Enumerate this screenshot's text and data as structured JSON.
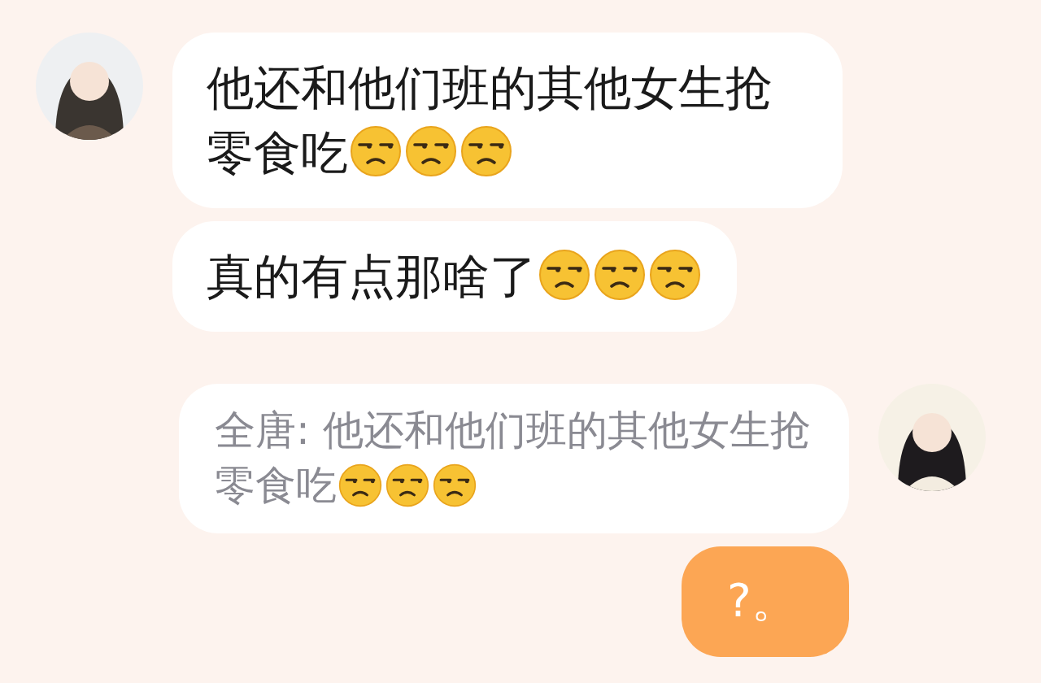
{
  "messages": [
    {
      "incoming": true,
      "kind": "text",
      "has_avatar": true,
      "segments": [
        {
          "kind": "text",
          "text": "他还和他们班的其他女生抢零食吃"
        },
        {
          "kind": "emoji"
        },
        {
          "kind": "emoji"
        },
        {
          "kind": "emoji"
        }
      ]
    },
    {
      "incoming": true,
      "kind": "text",
      "has_avatar": false,
      "segments": [
        {
          "kind": "text",
          "text": "真的有点那啥了"
        },
        {
          "kind": "emoji"
        },
        {
          "kind": "emoji"
        },
        {
          "kind": "emoji"
        }
      ]
    },
    {
      "incoming": false,
      "kind": "quote",
      "has_avatar": true,
      "segments": [
        {
          "kind": "text",
          "text": "全唐: 他还和他们班的其他女生抢零食吃"
        },
        {
          "kind": "emoji"
        },
        {
          "kind": "emoji"
        },
        {
          "kind": "emoji"
        }
      ]
    },
    {
      "incoming": false,
      "kind": "own",
      "has_avatar": false,
      "segments": [
        {
          "kind": "text",
          "text": "?。"
        }
      ]
    }
  ]
}
